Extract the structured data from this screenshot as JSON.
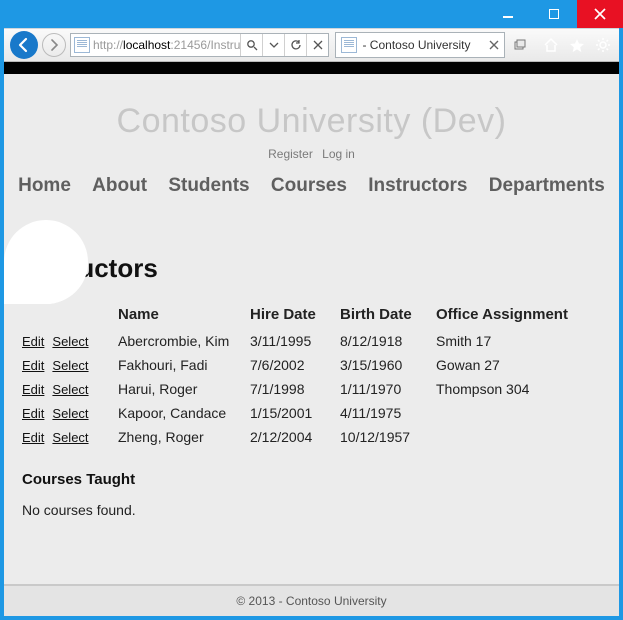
{
  "browser": {
    "url_prefix": "http://",
    "url_host": "localhost",
    "url_rest": ":21456/Instru",
    "tab_title": " - Contoso University"
  },
  "site": {
    "title": "Contoso University  (Dev)",
    "auth": {
      "register": "Register",
      "login": "Log in"
    },
    "nav": [
      "Home",
      "About",
      "Students",
      "Courses",
      "Instructors",
      "Departments"
    ]
  },
  "page": {
    "heading": "Instructors",
    "columns": [
      "Name",
      "Hire Date",
      "Birth Date",
      "Office Assignment"
    ],
    "row_actions": {
      "edit": "Edit",
      "select": "Select"
    },
    "rows": [
      {
        "name": "Abercrombie, Kim",
        "hire": "3/11/1995",
        "birth": "8/12/1918",
        "office": "Smith 17"
      },
      {
        "name": "Fakhouri, Fadi",
        "hire": "7/6/2002",
        "birth": "3/15/1960",
        "office": "Gowan 27"
      },
      {
        "name": "Harui, Roger",
        "hire": "7/1/1998",
        "birth": "1/11/1970",
        "office": "Thompson 304"
      },
      {
        "name": "Kapoor, Candace",
        "hire": "1/15/2001",
        "birth": "4/11/1975",
        "office": ""
      },
      {
        "name": "Zheng, Roger",
        "hire": "2/12/2004",
        "birth": "10/12/1957",
        "office": ""
      }
    ],
    "courses_heading": "Courses Taught",
    "no_courses": "No courses found."
  },
  "footer": "© 2013 - Contoso University"
}
